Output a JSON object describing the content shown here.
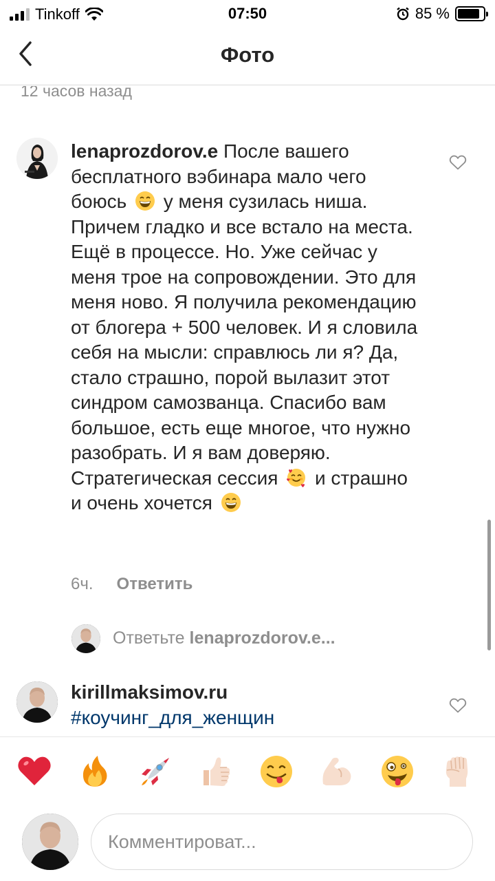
{
  "status_bar": {
    "carrier": "Tinkoff",
    "time": "07:50",
    "battery": "85 %",
    "battery_level": 0.85
  },
  "nav": {
    "title": "Фото"
  },
  "previous_timestamp": "12 часов назад",
  "comment": {
    "username": "lenaprozdorov.e",
    "text_parts": [
      "После вашего бесплатного вэбинара мало чего боюсь",
      "у меня сузилась ниша. Причем гладко и все встало на места. Ещё в процессе. Но. Уже сейчас у меня трое на сопровождении. Это для меня ново. Я получила рекомендацию от блогера + 500 человек. И я словила себя на мысли: справлюсь ли я? Да, стало страшно, порой вылазит этот синдром самозванца. Спасибо вам большое, есть еще многое, что нужно разобрать. И я вам доверяю. Стратегическая сессия",
      "и страшно и очень хочется"
    ],
    "time_ago": "6ч.",
    "reply_label": "Ответить"
  },
  "reply_prompt": {
    "prefix": "Ответьте",
    "username": "lenaprozdorov.e..."
  },
  "comment2": {
    "username": "kirillmaksimov.ru",
    "hashtag": "#коучинг_для_женщин"
  },
  "quick_emojis": [
    "heart",
    "fire",
    "rocket",
    "thumbs-up",
    "yum",
    "flexed-biceps",
    "zany-face",
    "raised-fist"
  ],
  "composer": {
    "placeholder": "Комментироват..."
  }
}
